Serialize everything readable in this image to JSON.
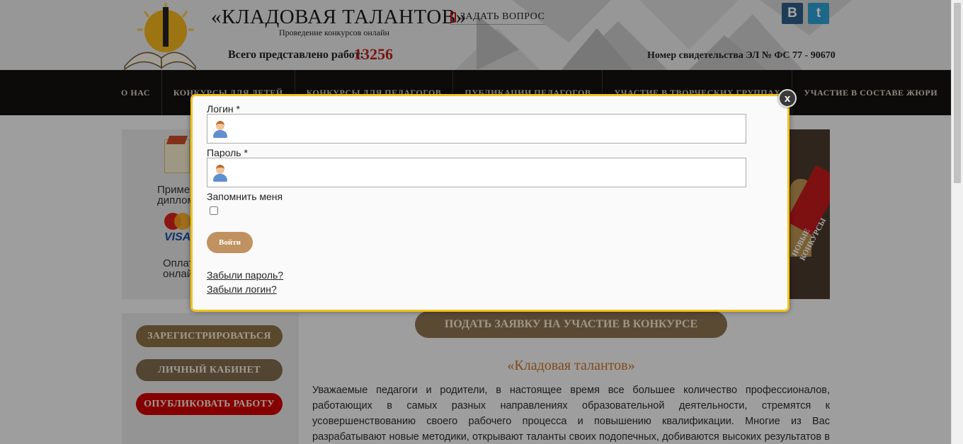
{
  "header": {
    "site_title": "«КЛАДОВАЯ ТАЛАНТОВ»",
    "site_subtitle": "Проведение конкурсов онлайн",
    "works_label": "Всего представлено работ:",
    "works_count": "13256",
    "ask_question": "ЗАДАТЬ ВОПРОС",
    "certificate": "Номер свидетельства ЭЛ № ФС 77 - 90670",
    "social": {
      "vk": "B",
      "twitter": "t"
    }
  },
  "nav": {
    "items": [
      "О НАС",
      "КОНКУРСЫ ДЛЯ ДЕТЕЙ",
      "КОНКУРСЫ ДЛЯ ПЕДАГОГОВ",
      "ПУБЛИКАЦИИ ПЕДАГОГОВ",
      "УЧАСТИЕ В ТВОРЧЕСКИХ ГРУППАХ",
      "УЧАСТИЕ В СОСТАВЕ ЖЮРИ"
    ]
  },
  "sidebar": {
    "box1_text": "Пример\nдиплом",
    "box2_text": "Оплат\nонлай",
    "visa": "VISA",
    "buttons": {
      "register": "ЗАРЕГИСТРИРОВАТЬСЯ",
      "cabinet": "ЛИЧНЫЙ КАБИНЕТ",
      "publish": "ОПУБЛИКОВАТЬ РАБОТУ"
    }
  },
  "banner": {
    "text": "НОВЫЕ\nКОНКУРСЫ"
  },
  "main": {
    "apply_button": "ПОДАТЬ ЗАЯВКУ НА УЧАСТИЕ В КОНКУРСЕ",
    "section_title": "«Кладовая талантов»",
    "intro": "Уважаемые педагоги и родители, в настоящее время все большее количество профессионалов, работающих в самых разных направлениях образовательной деятельности, стремятся к усовершенствованию своего рабочего процесса и повышению квалификации. Многие из Вас разрабатывают новые методики, открывают таланты своих подопечных, добиваются высоких результатов в своей профессиональной деятельности и именно для Вас мы создали портал"
  },
  "modal": {
    "close": "x",
    "login_label": "Логин *",
    "login_value": "",
    "password_label": "Пароль *",
    "password_value": "",
    "remember_label": "Запомнить меня",
    "submit": "Войти",
    "forgot_password": "Забыли пароль?",
    "forgot_login": "Забыли логин?"
  },
  "colors": {
    "accent": "#f0c21f",
    "nav_bg": "#15120e",
    "button_brown": "#c09260",
    "counter_red": "#b8201a"
  }
}
